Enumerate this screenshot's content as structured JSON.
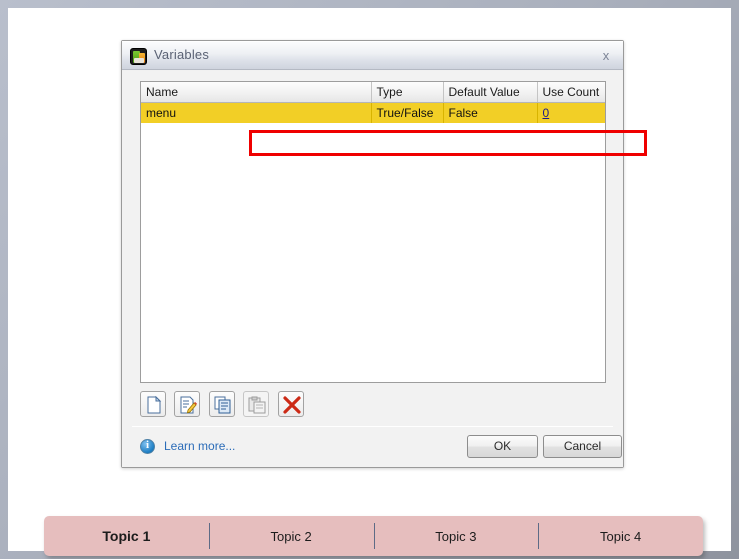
{
  "dialog": {
    "icon_name": "captivate-app-icon",
    "title": "Variables",
    "close_label": "x",
    "table": {
      "columns": [
        "Name",
        "Type",
        "Default Value",
        "Use Count"
      ],
      "rows": [
        {
          "name": "menu",
          "type": "True/False",
          "default_value": "False",
          "use_count": "0",
          "selected": true
        }
      ]
    },
    "toolbar": {
      "buttons": [
        {
          "name": "new-variable-button",
          "icon": "new-document-icon",
          "disabled": false
        },
        {
          "name": "edit-variable-button",
          "icon": "edit-document-icon",
          "disabled": false
        },
        {
          "name": "copy-variable-button",
          "icon": "copy-icon",
          "disabled": false
        },
        {
          "name": "paste-variable-button",
          "icon": "paste-icon",
          "disabled": true
        },
        {
          "name": "delete-variable-button",
          "icon": "delete-x-icon",
          "disabled": false
        }
      ]
    },
    "footer": {
      "info_icon": "info-icon",
      "learn_more": "Learn more...",
      "ok_label": "OK",
      "cancel_label": "Cancel"
    }
  },
  "annotation": {
    "highlight_color": "#ef0000",
    "selection_color": "#f2cf26"
  },
  "tabbar": {
    "background_color": "#e6bebe",
    "tabs": [
      {
        "label": "Topic 1",
        "active": true
      },
      {
        "label": "Topic 2",
        "active": false
      },
      {
        "label": "Topic 3",
        "active": false
      },
      {
        "label": "Topic 4",
        "active": false
      }
    ]
  }
}
